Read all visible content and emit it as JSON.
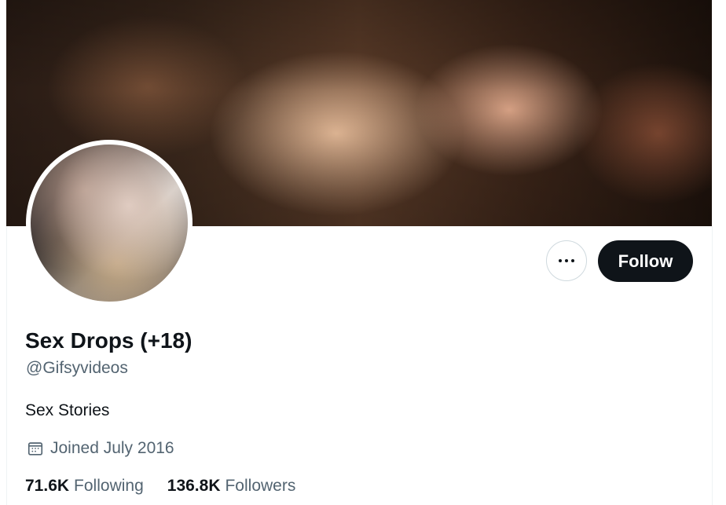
{
  "profile": {
    "display_name": "Sex Drops (+18)",
    "handle": "@Gifsyvideos",
    "bio": "Sex Stories",
    "joined": "Joined July 2016"
  },
  "stats": {
    "following_value": "71.6K",
    "following_label": "Following",
    "followers_value": "136.8K",
    "followers_label": "Followers"
  },
  "actions": {
    "follow_label": "Follow"
  },
  "icons": {
    "more": "more-horizontal-icon",
    "calendar": "calendar-icon"
  },
  "colors": {
    "primary_text": "#0f1419",
    "secondary_text": "#536471",
    "follow_button_bg": "#0f1419",
    "border": "#cfd9de"
  }
}
